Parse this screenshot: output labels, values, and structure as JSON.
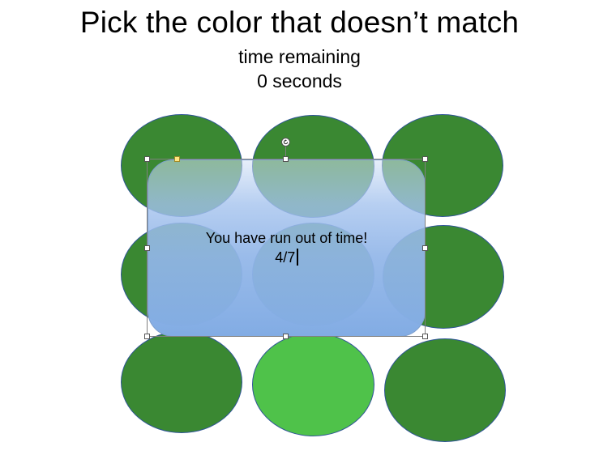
{
  "slide": {
    "title": "Pick the color that doesn’t match",
    "timer_label": "time remaining",
    "timer_value": "0 seconds"
  },
  "circles": [
    {
      "name": "circle-r1c1",
      "color": "#3a8832",
      "odd": false
    },
    {
      "name": "circle-r1c2",
      "color": "#3a8832",
      "odd": false
    },
    {
      "name": "circle-r1c3",
      "color": "#3a8832",
      "odd": false
    },
    {
      "name": "circle-r2c1",
      "color": "#3a8832",
      "odd": false
    },
    {
      "name": "circle-r2c2",
      "color": "#3a8832",
      "odd": false
    },
    {
      "name": "circle-r2c3",
      "color": "#3a8832",
      "odd": false
    },
    {
      "name": "circle-r3c1",
      "color": "#3a8832",
      "odd": false
    },
    {
      "name": "circle-r3c2",
      "color": "#4fc24a",
      "odd": true
    },
    {
      "name": "circle-r3c3",
      "color": "#3a8832",
      "odd": false
    }
  ],
  "overlay": {
    "message": "You have run out of time!",
    "score": "4/7"
  },
  "selection": {
    "rotate_icon": "rotate-icon"
  }
}
